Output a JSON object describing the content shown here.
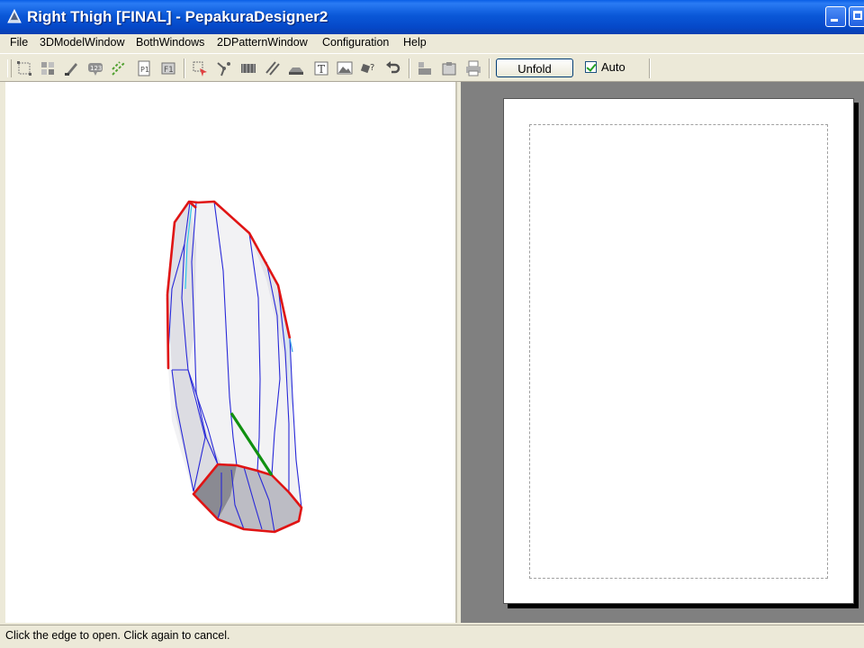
{
  "window": {
    "title": "Right Thigh [FINAL] - PepakuraDesigner2"
  },
  "menu": [
    "File",
    "3DModelWindow",
    "BothWindows",
    "2DPatternWindow",
    "Configuration",
    "Help"
  ],
  "toolbar": {
    "tools": [
      "select-icon",
      "grid-icon",
      "paint-icon",
      "number-icon",
      "fold-line-icon",
      "page-icon",
      "flap-icon",
      "open-edge-icon",
      "join-edge-icon",
      "texture-icon",
      "edge-lines-icon",
      "flap-tool-icon",
      "text-icon",
      "image-icon",
      "rotate-icon",
      "undo-icon",
      "layout-icon",
      "clipboard-icon",
      "print-icon"
    ],
    "unfold_label": "Unfold",
    "auto_label": "Auto",
    "auto_checked": true
  },
  "status": {
    "text": "Click the edge to open. Click again to cancel."
  },
  "colors": {
    "title_bar": "#0a58d8",
    "cut_edge": "#e01010",
    "mesh_edge": "#2020d0",
    "selected_edge": "#109010",
    "viewport_2d": "#808080"
  }
}
